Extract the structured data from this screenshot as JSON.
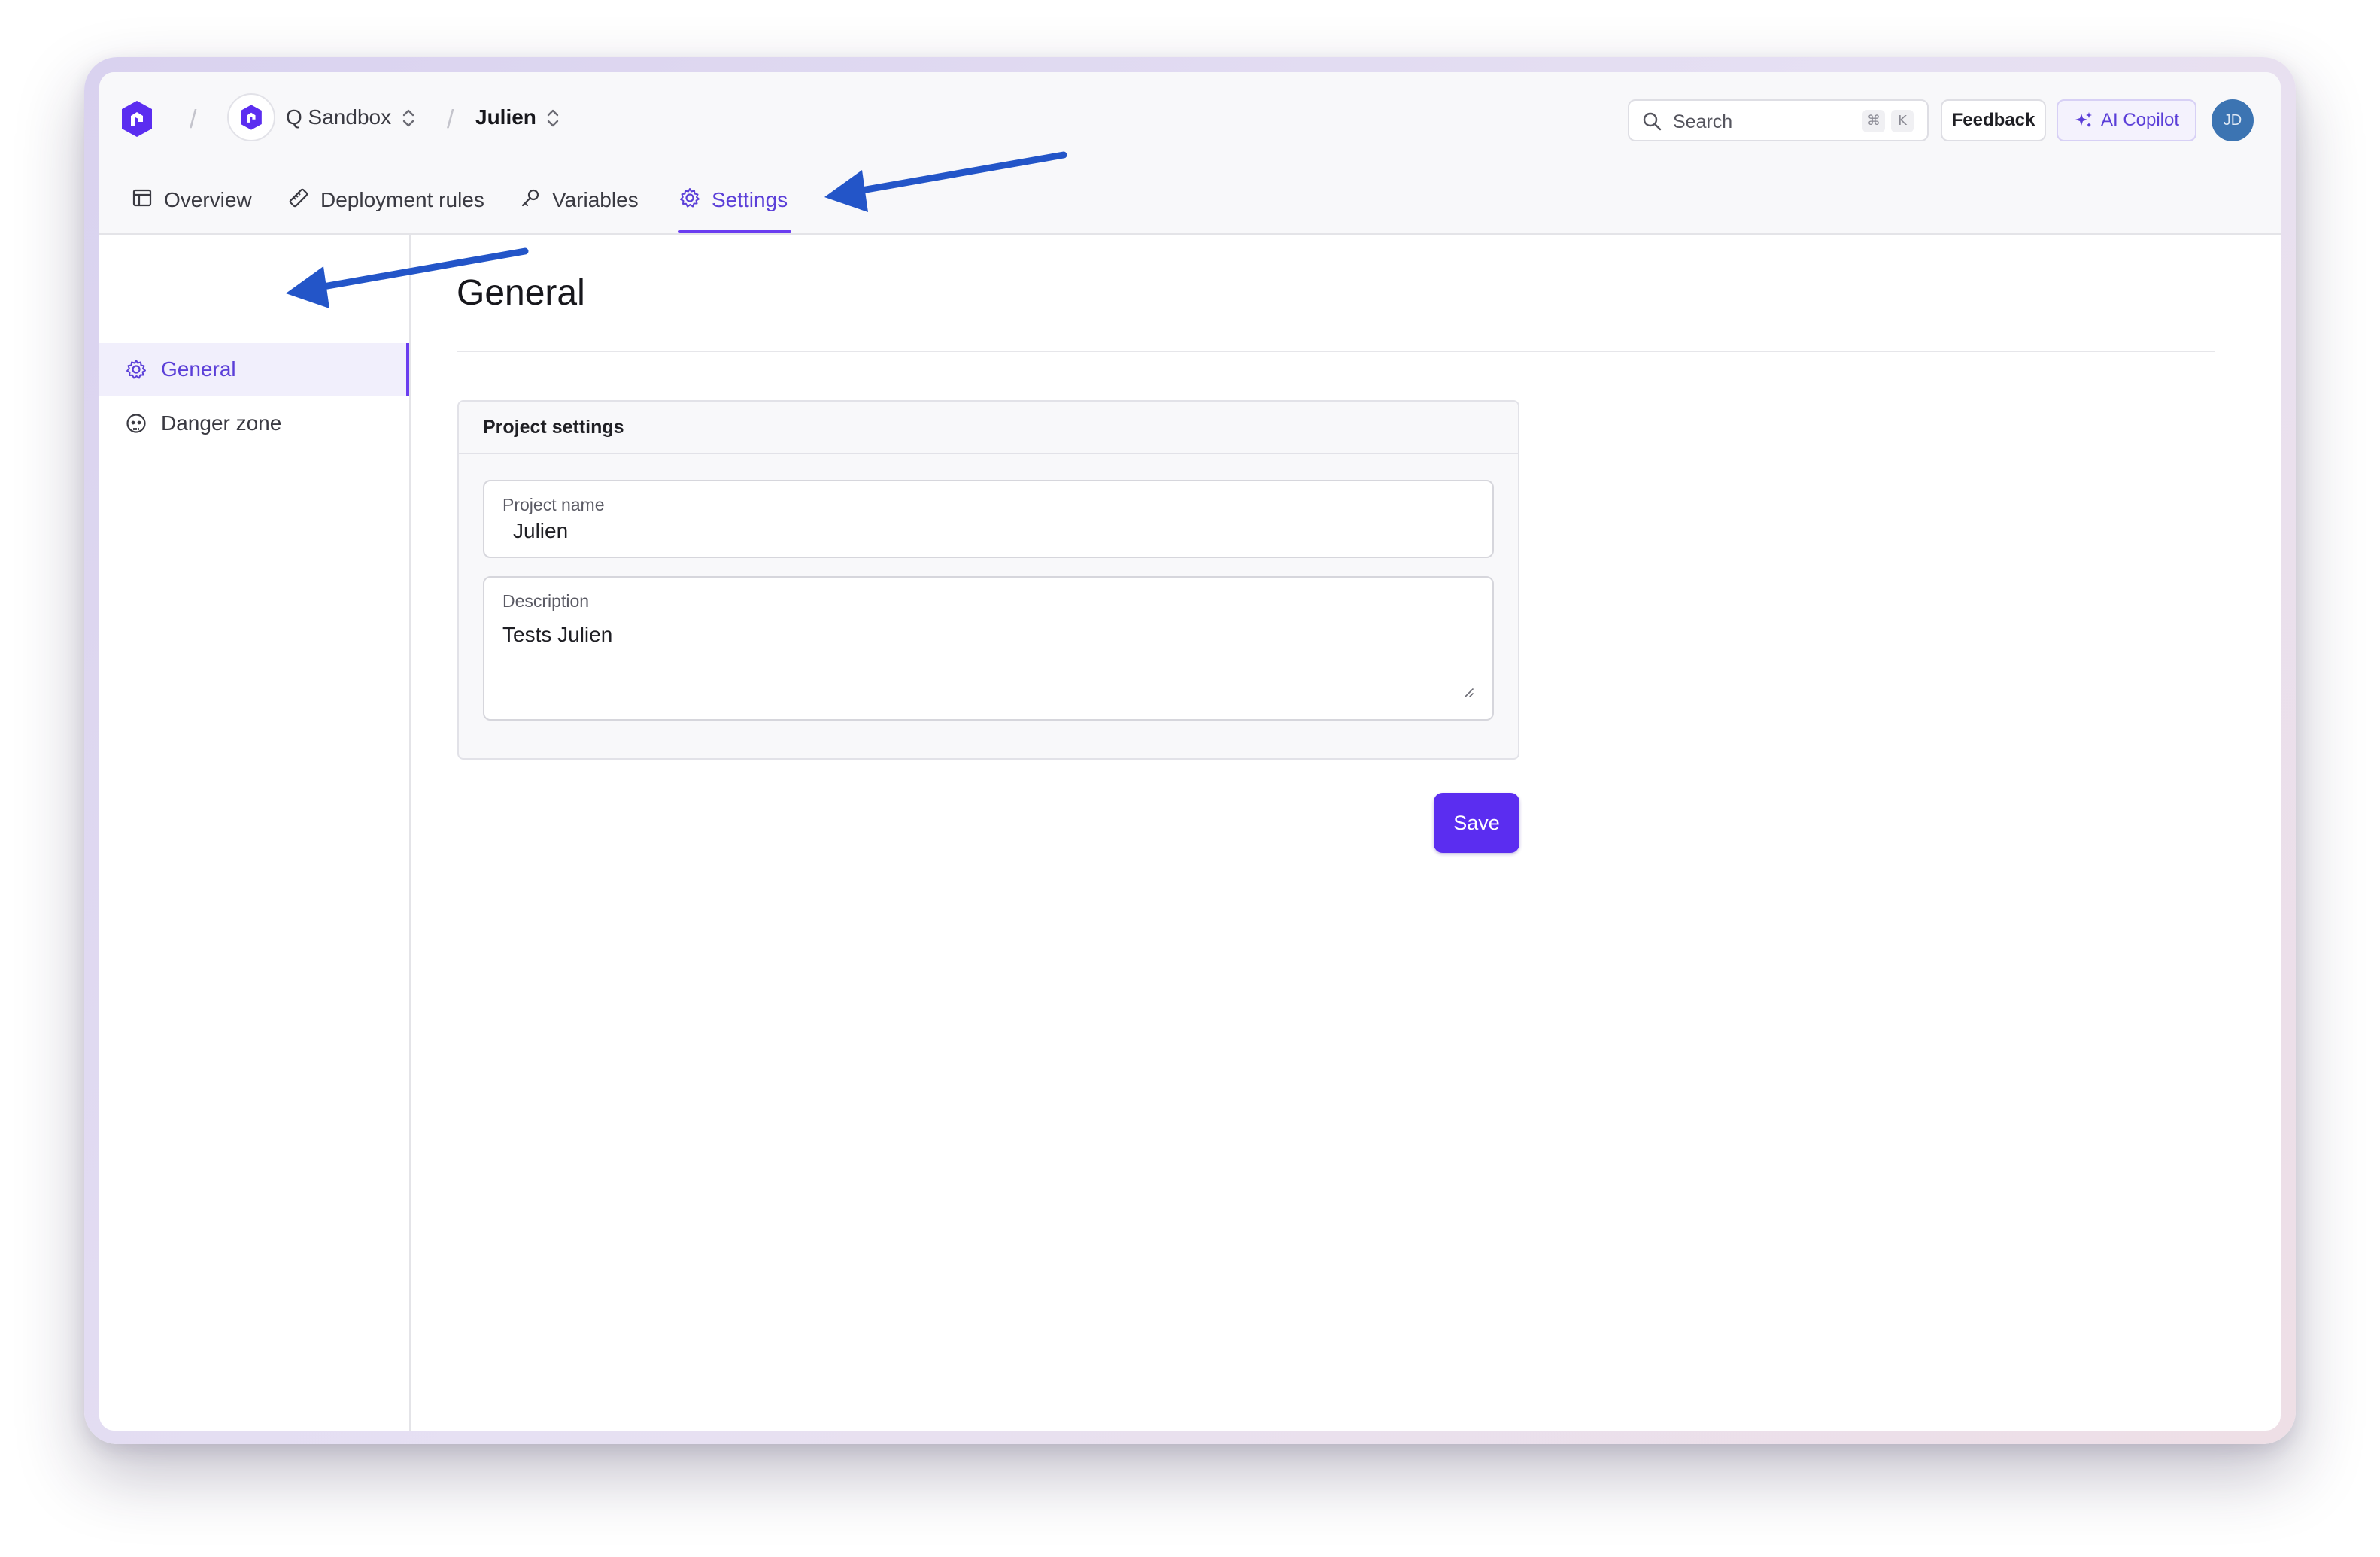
{
  "breadcrumb": {
    "organization": "Q Sandbox",
    "project": "Julien"
  },
  "search": {
    "placeholder": "Search",
    "shortcut_mod": "⌘",
    "shortcut_key": "K"
  },
  "header": {
    "feedback_label": "Feedback",
    "copilot_label": "AI Copilot",
    "avatar_initials": "JD"
  },
  "tabs": [
    {
      "label": "Overview",
      "icon": "layout-icon"
    },
    {
      "label": "Deployment rules",
      "icon": "ruler-icon"
    },
    {
      "label": "Variables",
      "icon": "key-icon"
    },
    {
      "label": "Settings",
      "icon": "gear-icon",
      "active": true
    }
  ],
  "sidebar": {
    "items": [
      {
        "label": "General",
        "icon": "gear-icon",
        "active": true
      },
      {
        "label": "Danger zone",
        "icon": "skull-icon"
      }
    ]
  },
  "main": {
    "title": "General",
    "card_title": "Project settings",
    "project_name": {
      "label": "Project name",
      "value": "Julien"
    },
    "description": {
      "label": "Description",
      "value": "Tests Julien"
    },
    "save_label": "Save"
  },
  "colors": {
    "accent": "#5b2df0",
    "annotation_arrow": "#2355c8",
    "avatar": "#3c74b2"
  }
}
